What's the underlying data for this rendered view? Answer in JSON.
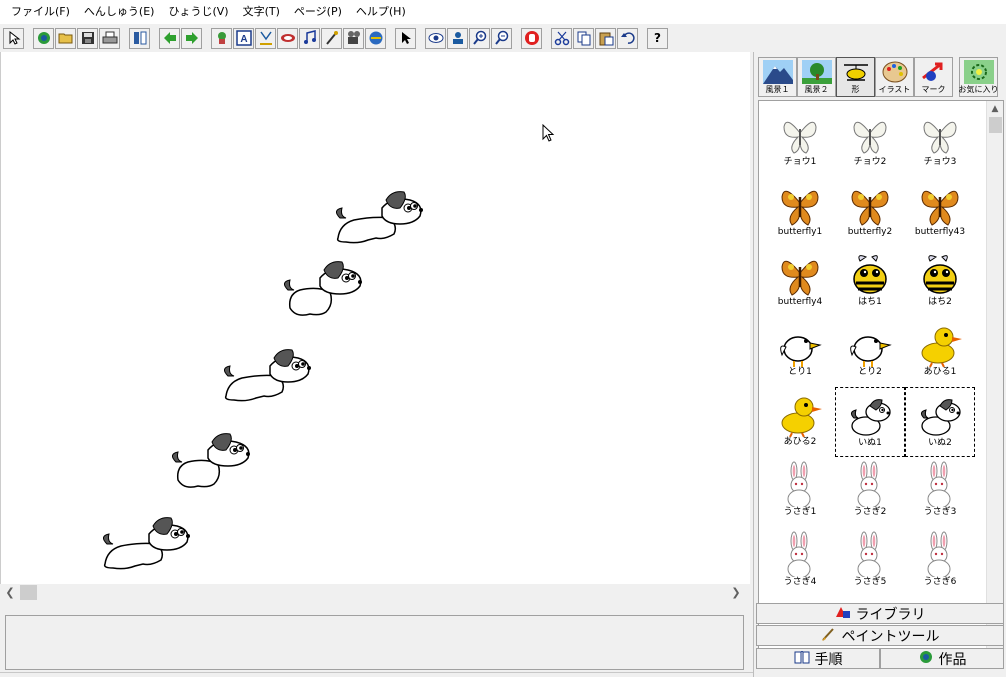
{
  "menu": [
    "ファイル(F)",
    "へんしゅう(E)",
    "ひょうじ(V)",
    "文字(T)",
    "ページ(P)",
    "ヘルプ(H)"
  ],
  "toolbar": {
    "icons": [
      "pointer-icon",
      "new-icon",
      "open-icon",
      "save-icon",
      "print-icon",
      "layout-icon",
      "back-arrow-icon",
      "forward-arrow-icon",
      "add-character-icon",
      "text-box-icon",
      "cut-figure-icon",
      "eraser-icon",
      "music-icon",
      "magic-wand-icon",
      "movie-icon",
      "globe-icon",
      "select-arrow-icon",
      "view-icon",
      "stamp-icon",
      "zoom-in-icon",
      "zoom-out-icon",
      "stop-hand-icon",
      "scissors-icon",
      "copy-icon",
      "paste-icon",
      "undo-icon",
      "help-icon"
    ],
    "help_label": "?"
  },
  "categories": [
    {
      "label": "風景１",
      "icon": "mountain-icon"
    },
    {
      "label": "風景２",
      "icon": "tree-icon"
    },
    {
      "label": "形",
      "icon": "helicopter-icon",
      "active": true
    },
    {
      "label": "イラスト",
      "icon": "palette-icon"
    },
    {
      "label": "マーク",
      "icon": "mark-arrow-icon"
    }
  ],
  "favorites_label": "お気に入り",
  "library": {
    "items": [
      {
        "name": "チョウ1",
        "kind": "butterfly-white"
      },
      {
        "name": "チョウ2",
        "kind": "butterfly-white"
      },
      {
        "name": "チョウ3",
        "kind": "butterfly-white"
      },
      {
        "name": "butterfly1",
        "kind": "butterfly-color"
      },
      {
        "name": "butterfly2",
        "kind": "butterfly-color"
      },
      {
        "name": "butterfly43",
        "kind": "butterfly-color"
      },
      {
        "name": "butterfly4",
        "kind": "butterfly-color"
      },
      {
        "name": "はち1",
        "kind": "bee"
      },
      {
        "name": "はち2",
        "kind": "bee"
      },
      {
        "name": "とり1",
        "kind": "bird"
      },
      {
        "name": "とり2",
        "kind": "bird"
      },
      {
        "name": "あひる1",
        "kind": "duck"
      },
      {
        "name": "あひる2",
        "kind": "duck"
      },
      {
        "name": "いぬ1",
        "kind": "dog",
        "selected": true
      },
      {
        "name": "いぬ2",
        "kind": "dog",
        "selected": true
      },
      {
        "name": "うさぎ1",
        "kind": "rabbit"
      },
      {
        "name": "うさぎ2",
        "kind": "rabbit"
      },
      {
        "name": "うさぎ3",
        "kind": "rabbit"
      },
      {
        "name": "うさぎ4",
        "kind": "rabbit"
      },
      {
        "name": "うさぎ5",
        "kind": "rabbit"
      },
      {
        "name": "うさぎ6",
        "kind": "rabbit"
      }
    ]
  },
  "tabs": {
    "library": "ライブラリ",
    "paint_tools": "ペイントツール",
    "procedure": "手順",
    "works": "作品"
  },
  "colors": {
    "dog_patch": "#555555",
    "duck": "#f5d000",
    "bee": "#f2cf14",
    "butterfly": "#e08a1e"
  }
}
